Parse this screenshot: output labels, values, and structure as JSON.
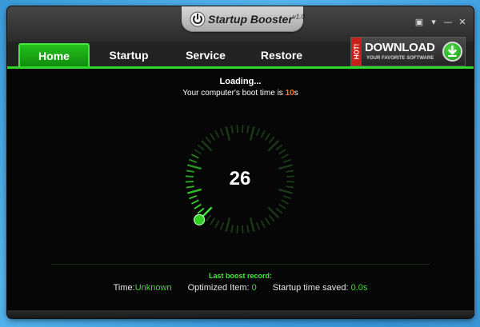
{
  "app": {
    "title": "Startup Booster",
    "version": "v1.0"
  },
  "window_controls": {
    "skin": "▣",
    "menu": "▾",
    "minimize": "—",
    "close": "✕"
  },
  "tabs": [
    {
      "label": "Home",
      "active": true
    },
    {
      "label": "Startup",
      "active": false
    },
    {
      "label": "Service",
      "active": false
    },
    {
      "label": "Restore",
      "active": false
    }
  ],
  "ad": {
    "hot": "HOT!",
    "title": "DOWNLOAD",
    "subtitle": "YOUR FAVORITE SOFTWARE"
  },
  "status": {
    "loading": "Loading...",
    "boot_prefix": "Your computer's boot time is ",
    "boot_value": "10",
    "boot_unit": "s"
  },
  "gauge": {
    "value": "26",
    "progress_fraction": 0.2
  },
  "record": {
    "title": "Last boost record:",
    "time_label": "Time:",
    "time_value": "Unknown",
    "optimized_label": "Optimized Item: ",
    "optimized_value": "0",
    "saved_label": "Startup time saved: ",
    "saved_value": "0.0s"
  },
  "colors": {
    "accent_green": "#2ed82a",
    "highlight_orange": "#ff7a2a",
    "background": "#060606"
  }
}
